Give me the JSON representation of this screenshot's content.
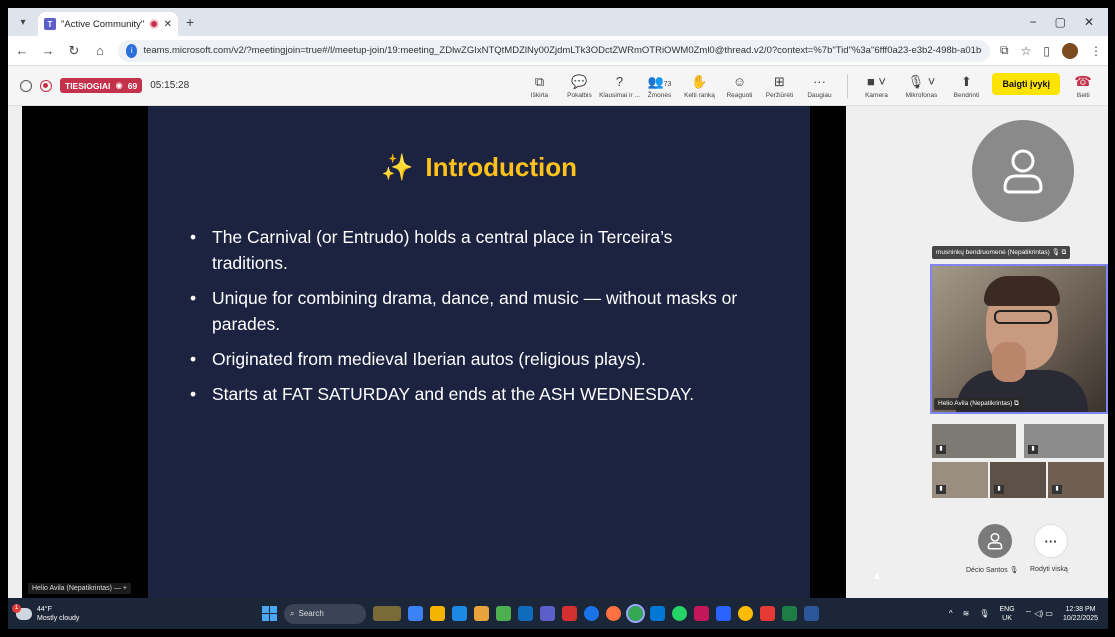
{
  "browser": {
    "tab_title": "\"Active Community\" - Shar",
    "url": "teams.microsoft.com/v2/?meetingjoin=true#/l/meetup-join/19:meeting_ZDlwZGIxNTQtMDZlNy00ZjdmLTk3ODctZWRmOTRiOWM0Zml0@thread.v2/0?context=%7b\"Tid\"%3a\"6fff0a23-e3b2-498b-a01b-2b12865344b3\"%2c\"Oid\"%3a\"fa759a5b-7...",
    "new_tab": "+",
    "window_controls": [
      "−",
      "▢",
      "✕"
    ]
  },
  "meeting": {
    "live_label": "TIESIOGIAI",
    "viewers": "69",
    "timer": "05:15:28",
    "tools": [
      {
        "label": "Iškirta",
        "icon": "⧉"
      },
      {
        "label": "Pokalbis",
        "icon": "💬"
      },
      {
        "label": "Klausimai ir ...",
        "icon": "?"
      },
      {
        "label": "Žmonės",
        "icon": "👥",
        "badge": "73"
      },
      {
        "label": "Kelti ranką",
        "icon": "✋"
      },
      {
        "label": "Reaguoti",
        "icon": "☺"
      },
      {
        "label": "Peržiūrėti",
        "icon": "⊞"
      },
      {
        "label": "Daugiau",
        "icon": "···"
      }
    ],
    "camera_label": "Kamera",
    "mic_label": "Mikrofonas",
    "share_label": "Bendrinti",
    "end_label": "Baigti įvykį",
    "leave_label": "Išeiti"
  },
  "slide": {
    "title": "Introduction",
    "bullets": [
      "The Carnival (or Entrudo) holds a central place in Terceira’s traditions.",
      "Unique for combining drama, dance, and music — without masks or parades.",
      "Originated from medieval Iberian autos (religious plays).",
      "Starts at FAT SATURDAY and ends at the ASH WEDNESDAY."
    ],
    "presenter_tag": "Helio Avila (Nepatikrintas)"
  },
  "participants": {
    "top_name": "musninkų bendruomenė (Nepatikrintas)",
    "cam_name": "Helio Avila (Nepatikrintas)",
    "bottom_name": "Décio Santos",
    "show_all": "Rodyti viską"
  },
  "taskbar": {
    "temp": "44°F",
    "weather": "Mostly cloudy",
    "search": "Search",
    "lang_top": "ENG",
    "lang_bottom": "UK",
    "time": "12:38 PM",
    "date": "10/22/2025"
  },
  "colors": {
    "slide_bg": "#1c2341",
    "title_yellow": "#ffc21a",
    "end_button": "#fde300",
    "live_red": "#c4314b",
    "accent": "#7f85f5"
  }
}
